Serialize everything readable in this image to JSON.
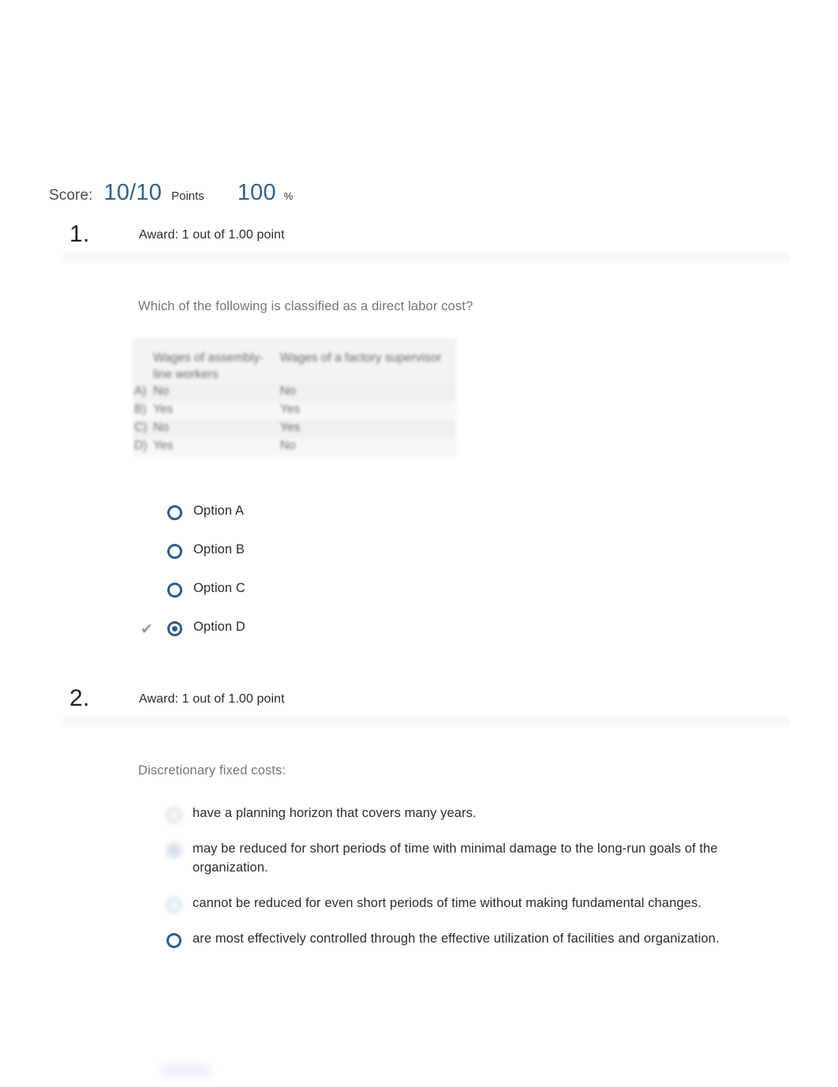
{
  "score": {
    "label": "Score:",
    "points_value": "10/10",
    "points_unit": "Points",
    "percent_value": "100",
    "percent_unit": "%"
  },
  "questions": [
    {
      "number": "1.",
      "award": "Award: 1 out of 1.00 point",
      "stem": "Which of the following is classified as a direct labor cost?",
      "table": {
        "headers": [
          "",
          "Wages of assembly-line workers",
          "Wages of a factory supervisor"
        ],
        "rows": [
          {
            "key": "A)",
            "col1": "No",
            "col2": "No"
          },
          {
            "key": "B)",
            "col1": "Yes",
            "col2": "Yes"
          },
          {
            "key": "C)",
            "col1": "No",
            "col2": "Yes"
          },
          {
            "key": "D)",
            "col1": "Yes",
            "col2": "No"
          }
        ]
      },
      "options": [
        {
          "label": "Option A",
          "selected": false,
          "correct": false,
          "blurred": false
        },
        {
          "label": "Option B",
          "selected": false,
          "correct": false,
          "blurred": false
        },
        {
          "label": "Option C",
          "selected": false,
          "correct": false,
          "blurred": false
        },
        {
          "label": "Option D",
          "selected": true,
          "correct": true,
          "blurred": false
        }
      ]
    },
    {
      "number": "2.",
      "award": "Award: 1 out of 1.00 point",
      "stem": "Discretionary fixed costs:",
      "options": [
        {
          "label": "have a planning horizon that covers many years.",
          "selected": false,
          "correct": false,
          "blurred": true
        },
        {
          "label": "may be reduced for short periods of time with minimal damage to the long-run goals of the organization.",
          "selected": true,
          "correct": false,
          "blurred": true
        },
        {
          "label": "cannot be reduced for even short periods of time without making fundamental changes.",
          "selected": false,
          "correct": false,
          "blurred": true
        },
        {
          "label": "are most effectively controlled through the effective utilization of facilities and organization.",
          "selected": false,
          "correct": false,
          "blurred": false
        }
      ]
    }
  ],
  "colors": {
    "accent_blue": "#35618c",
    "radio_blue": "#2f5d8c",
    "stem_gray": "#767676",
    "check_gray": "#9b9b9b"
  },
  "icons": {
    "correct_check": "✔"
  }
}
